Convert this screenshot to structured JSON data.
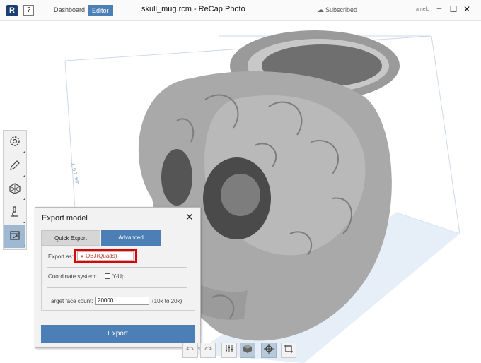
{
  "titlebar": {
    "logo": "R",
    "help": "?",
    "nav_dashboard": "Dashboard",
    "nav_editor": "Editor",
    "document_title": "skull_mug.rcm - ReCap Photo",
    "subscribed": "Subscribed",
    "user": "amelo",
    "minimize": "–",
    "maximize": "☐",
    "close": "✕"
  },
  "toolbar": {
    "icons": [
      "gear-icon",
      "pencil-icon",
      "mesh-icon",
      "microscope-icon",
      "export-icon"
    ],
    "active": "export-icon"
  },
  "export_panel": {
    "title": "Export model",
    "close": "✕",
    "tabs": {
      "quick": "Quick Export",
      "advanced": "Advanced",
      "active": "Advanced"
    },
    "export_as_label": "Export as:",
    "export_as_value": "OBJ(Quads)",
    "coordinate_label": "Coordinate system:",
    "yup_label": "Y-Up",
    "face_count_label": "Target face count:",
    "face_count_value": "20000",
    "face_count_range": "(10k to 20k)",
    "export_button": "Export"
  },
  "bottom_toolbar": {
    "buttons": [
      "undo-icon",
      "redo-icon",
      "sliders-icon",
      "cube-icon",
      "target-icon",
      "crop-icon"
    ]
  },
  "colors": {
    "accent": "#4b7fb5",
    "highlight": "#e00000",
    "toolbar_active": "#9fb9d2"
  }
}
